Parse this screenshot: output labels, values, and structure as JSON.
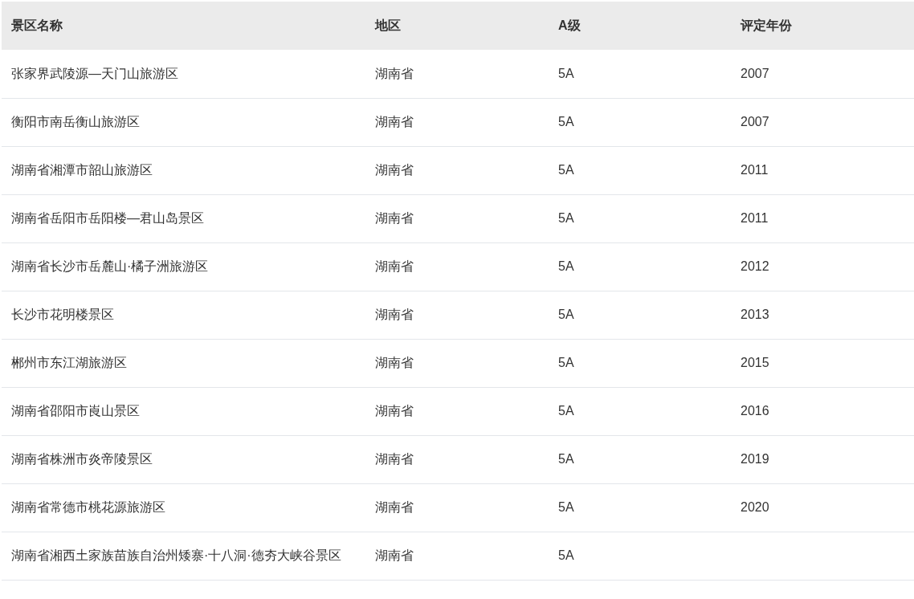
{
  "table": {
    "columns": [
      "景区名称",
      "地区",
      "A级",
      "评定年份"
    ],
    "rows": [
      {
        "name": "张家界武陵源—天门山旅游区",
        "region": "湖南省",
        "grade": "5A",
        "year": "2007"
      },
      {
        "name": "衡阳市南岳衡山旅游区",
        "region": "湖南省",
        "grade": "5A",
        "year": "2007"
      },
      {
        "name": "湖南省湘潭市韶山旅游区",
        "region": "湖南省",
        "grade": "5A",
        "year": "2011"
      },
      {
        "name": "湖南省岳阳市岳阳楼—君山岛景区",
        "region": "湖南省",
        "grade": "5A",
        "year": "2011"
      },
      {
        "name": "湖南省长沙市岳麓山·橘子洲旅游区",
        "region": "湖南省",
        "grade": "5A",
        "year": "2012"
      },
      {
        "name": "长沙市花明楼景区",
        "region": "湖南省",
        "grade": "5A",
        "year": "2013"
      },
      {
        "name": "郴州市东江湖旅游区",
        "region": "湖南省",
        "grade": "5A",
        "year": "2015"
      },
      {
        "name": "湖南省邵阳市崀山景区",
        "region": "湖南省",
        "grade": "5A",
        "year": "2016"
      },
      {
        "name": "湖南省株洲市炎帝陵景区",
        "region": "湖南省",
        "grade": "5A",
        "year": "2019"
      },
      {
        "name": "湖南省常德市桃花源旅游区",
        "region": "湖南省",
        "grade": "5A",
        "year": "2020"
      },
      {
        "name": "湖南省湘西土家族苗族自治州矮寨·十八洞·德夯大峡谷景区",
        "region": "湖南省",
        "grade": "5A"
      }
    ]
  }
}
